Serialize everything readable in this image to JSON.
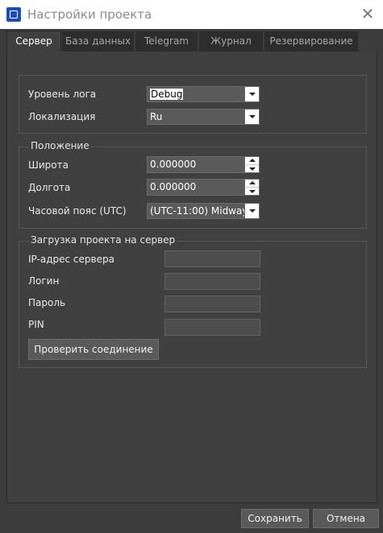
{
  "window": {
    "title": "Настройки проекта",
    "icon": "app-icon",
    "close_icon": "close-icon"
  },
  "tabs": [
    {
      "label": "Сервер",
      "active": true
    },
    {
      "label": "База данных",
      "active": false
    },
    {
      "label": "Telegram",
      "active": false
    },
    {
      "label": "Журнал",
      "active": false
    },
    {
      "label": "Резервирование",
      "active": false
    }
  ],
  "general": {
    "log_level_label": "Уровень лога",
    "log_level_value": "Debug",
    "locale_label": "Локализация",
    "locale_value": "Ru"
  },
  "position": {
    "title": "Положение",
    "latitude_label": "Широта",
    "latitude_value": "0.000000",
    "longitude_label": "Долгота",
    "longitude_value": "0.000000",
    "timezone_label": "Часовой пояс (UTC)",
    "timezone_value": "(UTC-11:00) Midway"
  },
  "upload": {
    "title": "Загрузка проекта на сервер",
    "ip_label": "IP-адрес сервера",
    "ip_value": "",
    "login_label": "Логин",
    "login_value": "",
    "password_label": "Пароль",
    "password_value": "",
    "pin_label": "PIN",
    "pin_value": "",
    "check_button": "Проверить соединение"
  },
  "footer": {
    "save_button": "Сохранить",
    "cancel_button": "Отмена"
  },
  "colors": {
    "background": "#3c3c3c",
    "panel": "#404040",
    "input": "#5a5a5a",
    "text": "#e6e6e6"
  }
}
